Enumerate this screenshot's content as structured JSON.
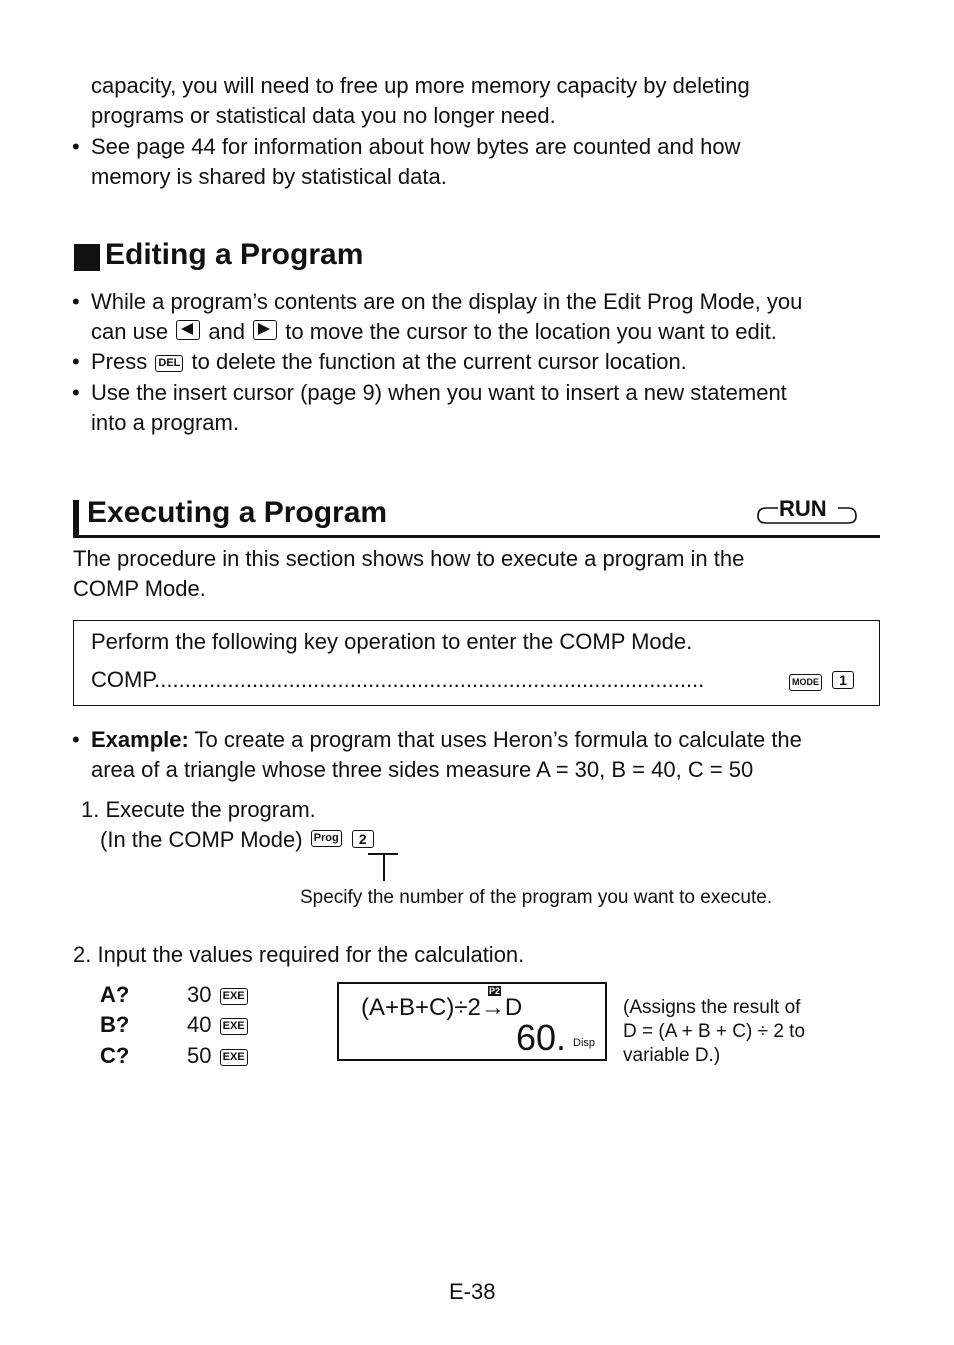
{
  "intro": {
    "lines": [
      "capacity, you will need to free up more memory capacity by deleting",
      "programs or statistical data you no longer need."
    ],
    "bullet_lines": [
      "See page 44 for information about how bytes are counted and how",
      "memory is shared by statistical data."
    ]
  },
  "editing": {
    "title": "Editing a Program",
    "b1_line1": "While a program’s contents are on the display in the Edit Prog Mode, you",
    "b1_pre": "can use",
    "b1_mid": "and",
    "b1_post": "to move the cursor to the location you want to edit.",
    "b2_pre": "Press",
    "b2_key": "DEL",
    "b2_post": "to delete the function at the current cursor location.",
    "b3_line1": "Use the insert cursor (page 9) when you want to insert a new statement",
    "b3_line2": "into a program."
  },
  "executing": {
    "title": "Executing a Program",
    "mode_badge": "RUN",
    "desc_line1": "The procedure in this section shows how to execute a program in the",
    "desc_line2": "COMP Mode.",
    "box_line1": "Perform the following key operation to enter the COMP Mode.",
    "box_label": "COMP",
    "box_dots": "..........................................................................................",
    "box_key1": "MODE",
    "box_key2": "1",
    "example_label": "Example:",
    "example_line1": "To create a program that uses Heron’s formula to calculate the",
    "example_line2": "area of a triangle whose three sides measure A = 30, B = 40, C = 50",
    "step1_line1": "1. Execute the program.",
    "step1_line2": "(In the COMP Mode)",
    "step1_key1": "Prog",
    "step1_key2": "2",
    "step1_note": "Specify the number of the program you want to execute.",
    "step2": "2. Input the values required for the calculation.",
    "inputs": [
      {
        "label": "A?",
        "value": "30",
        "key": "EXE"
      },
      {
        "label": "B?",
        "value": "40",
        "key": "EXE"
      },
      {
        "label": "C?",
        "value": "50",
        "key": "EXE"
      }
    ],
    "display": {
      "indicator": "P2",
      "formula": "(A+B+C)÷2→D",
      "result": "60.",
      "disp": "Disp"
    },
    "note_lines": [
      "(Assigns the result of",
      "D = (A + B + C) ÷ 2 to",
      "variable D.)"
    ]
  },
  "footer": {
    "page_number": "E-38"
  }
}
